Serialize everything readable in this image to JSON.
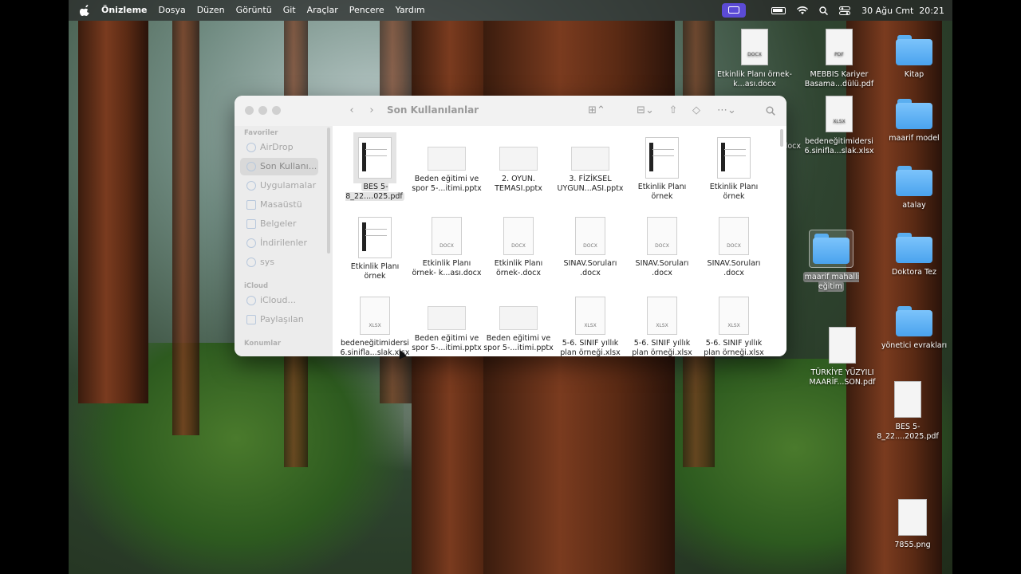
{
  "menubar": {
    "app_name": "Önizleme",
    "items": [
      "Dosya",
      "Düzen",
      "Görüntü",
      "Git",
      "Araçlar",
      "Pencere",
      "Yardım"
    ],
    "datetime": "30 Ağu Cmt  20:21",
    "icons": [
      "apple-icon",
      "screen-record-icon",
      "battery-icon",
      "wifi-icon",
      "spotlight-icon",
      "control-center-icon"
    ]
  },
  "finder": {
    "title": "Son Kullanılanlar",
    "sidebar": {
      "favorites_header": "Favoriler",
      "favorites": [
        "AirDrop",
        "Son Kullanı...",
        "Uygulamalar",
        "Masaüstü",
        "Belgeler",
        "İndirilenler",
        "sys"
      ],
      "icloud_header": "iCloud",
      "icloud": [
        "iCloud...",
        "Paylaşılan"
      ],
      "tags_header": "Konumlar"
    },
    "files": [
      {
        "name": "BES 5-8_22....025.pdf",
        "type": "pdf",
        "selected": true
      },
      {
        "name": "Beden eğitimi ve spor 5-...itimi.pptx",
        "type": "pptx"
      },
      {
        "name": "2. OYUN. TEMASI.pptx",
        "type": "pptx"
      },
      {
        "name": "3. FİZİKSEL UYGUN...ASI.pptx",
        "type": "pptx"
      },
      {
        "name": "Etkinlik Planı örnek",
        "type": "pdf"
      },
      {
        "name": "Etkinlik Planı örnek",
        "type": "pdf"
      },
      {
        "name": "Etkinlik Planı örnek",
        "type": "pdf"
      },
      {
        "name": "Etkinlik Planı örnek- k...ası.docx",
        "type": "docx",
        "tag": "DOCX"
      },
      {
        "name": "Etkinlik Planı örnek-.docx",
        "type": "docx",
        "tag": "DOCX"
      },
      {
        "name": "SINAV.Soruları .docx",
        "type": "docx",
        "tag": "DOCX"
      },
      {
        "name": "SINAV.Soruları .docx",
        "type": "docx",
        "tag": "DOCX"
      },
      {
        "name": "SINAV.Soruları .docx",
        "type": "docx",
        "tag": "DOCX"
      },
      {
        "name": "bedeneğitimidersi 6.sinifla...slak.xlsx",
        "type": "xlsx",
        "tag": "XLSX"
      },
      {
        "name": "Beden eğitimi ve spor 5-...itimi.pptx",
        "type": "pptx"
      },
      {
        "name": "Beden eğitimi ve spor 5-...itimi.pptx",
        "type": "pptx"
      },
      {
        "name": "5-6. SINIF yıllık plan örneği.xlsx",
        "type": "xlsx",
        "tag": "XLSX"
      },
      {
        "name": "5-6. SINIF yıllık plan örneği.xlsx",
        "type": "xlsx",
        "tag": "XLSX"
      },
      {
        "name": "5-6. SINIF yıllık plan örneği.xlsx",
        "type": "xlsx",
        "tag": "XLSX"
      }
    ]
  },
  "desktop": {
    "items": [
      {
        "name": "Etkinlik Planı örnek- k...ası.docx",
        "type": "docx",
        "tag": "DOCX"
      },
      {
        "name": "MEBBIS Kariyer Basama...dülü.pdf",
        "type": "pdf",
        "tag": "PDF"
      },
      {
        "name": "Kitap",
        "type": "folder"
      },
      {
        "name": "bedeneğitimidersi 6.sinifla...slak.xlsx",
        "type": "xlsx",
        "tag": "XLSX"
      },
      {
        "name": "maarif model",
        "type": "folder"
      },
      {
        "name": "atalay",
        "type": "folder"
      },
      {
        "name": "maarif mahalli eğitim",
        "type": "folder",
        "selected": true
      },
      {
        "name": "Doktora Tez",
        "type": "folder"
      },
      {
        "name": "yönetici evrakları",
        "type": "folder"
      },
      {
        "name": "TÜRKİYE YÜZYILI MAARİF...SON.pdf",
        "type": "pdf"
      },
      {
        "name": "BES 5-8_22....2025.pdf",
        "type": "pdf"
      },
      {
        "name": "7855.png",
        "type": "png"
      },
      {
        "name": "...anı ...docx",
        "type": "partial"
      }
    ]
  }
}
